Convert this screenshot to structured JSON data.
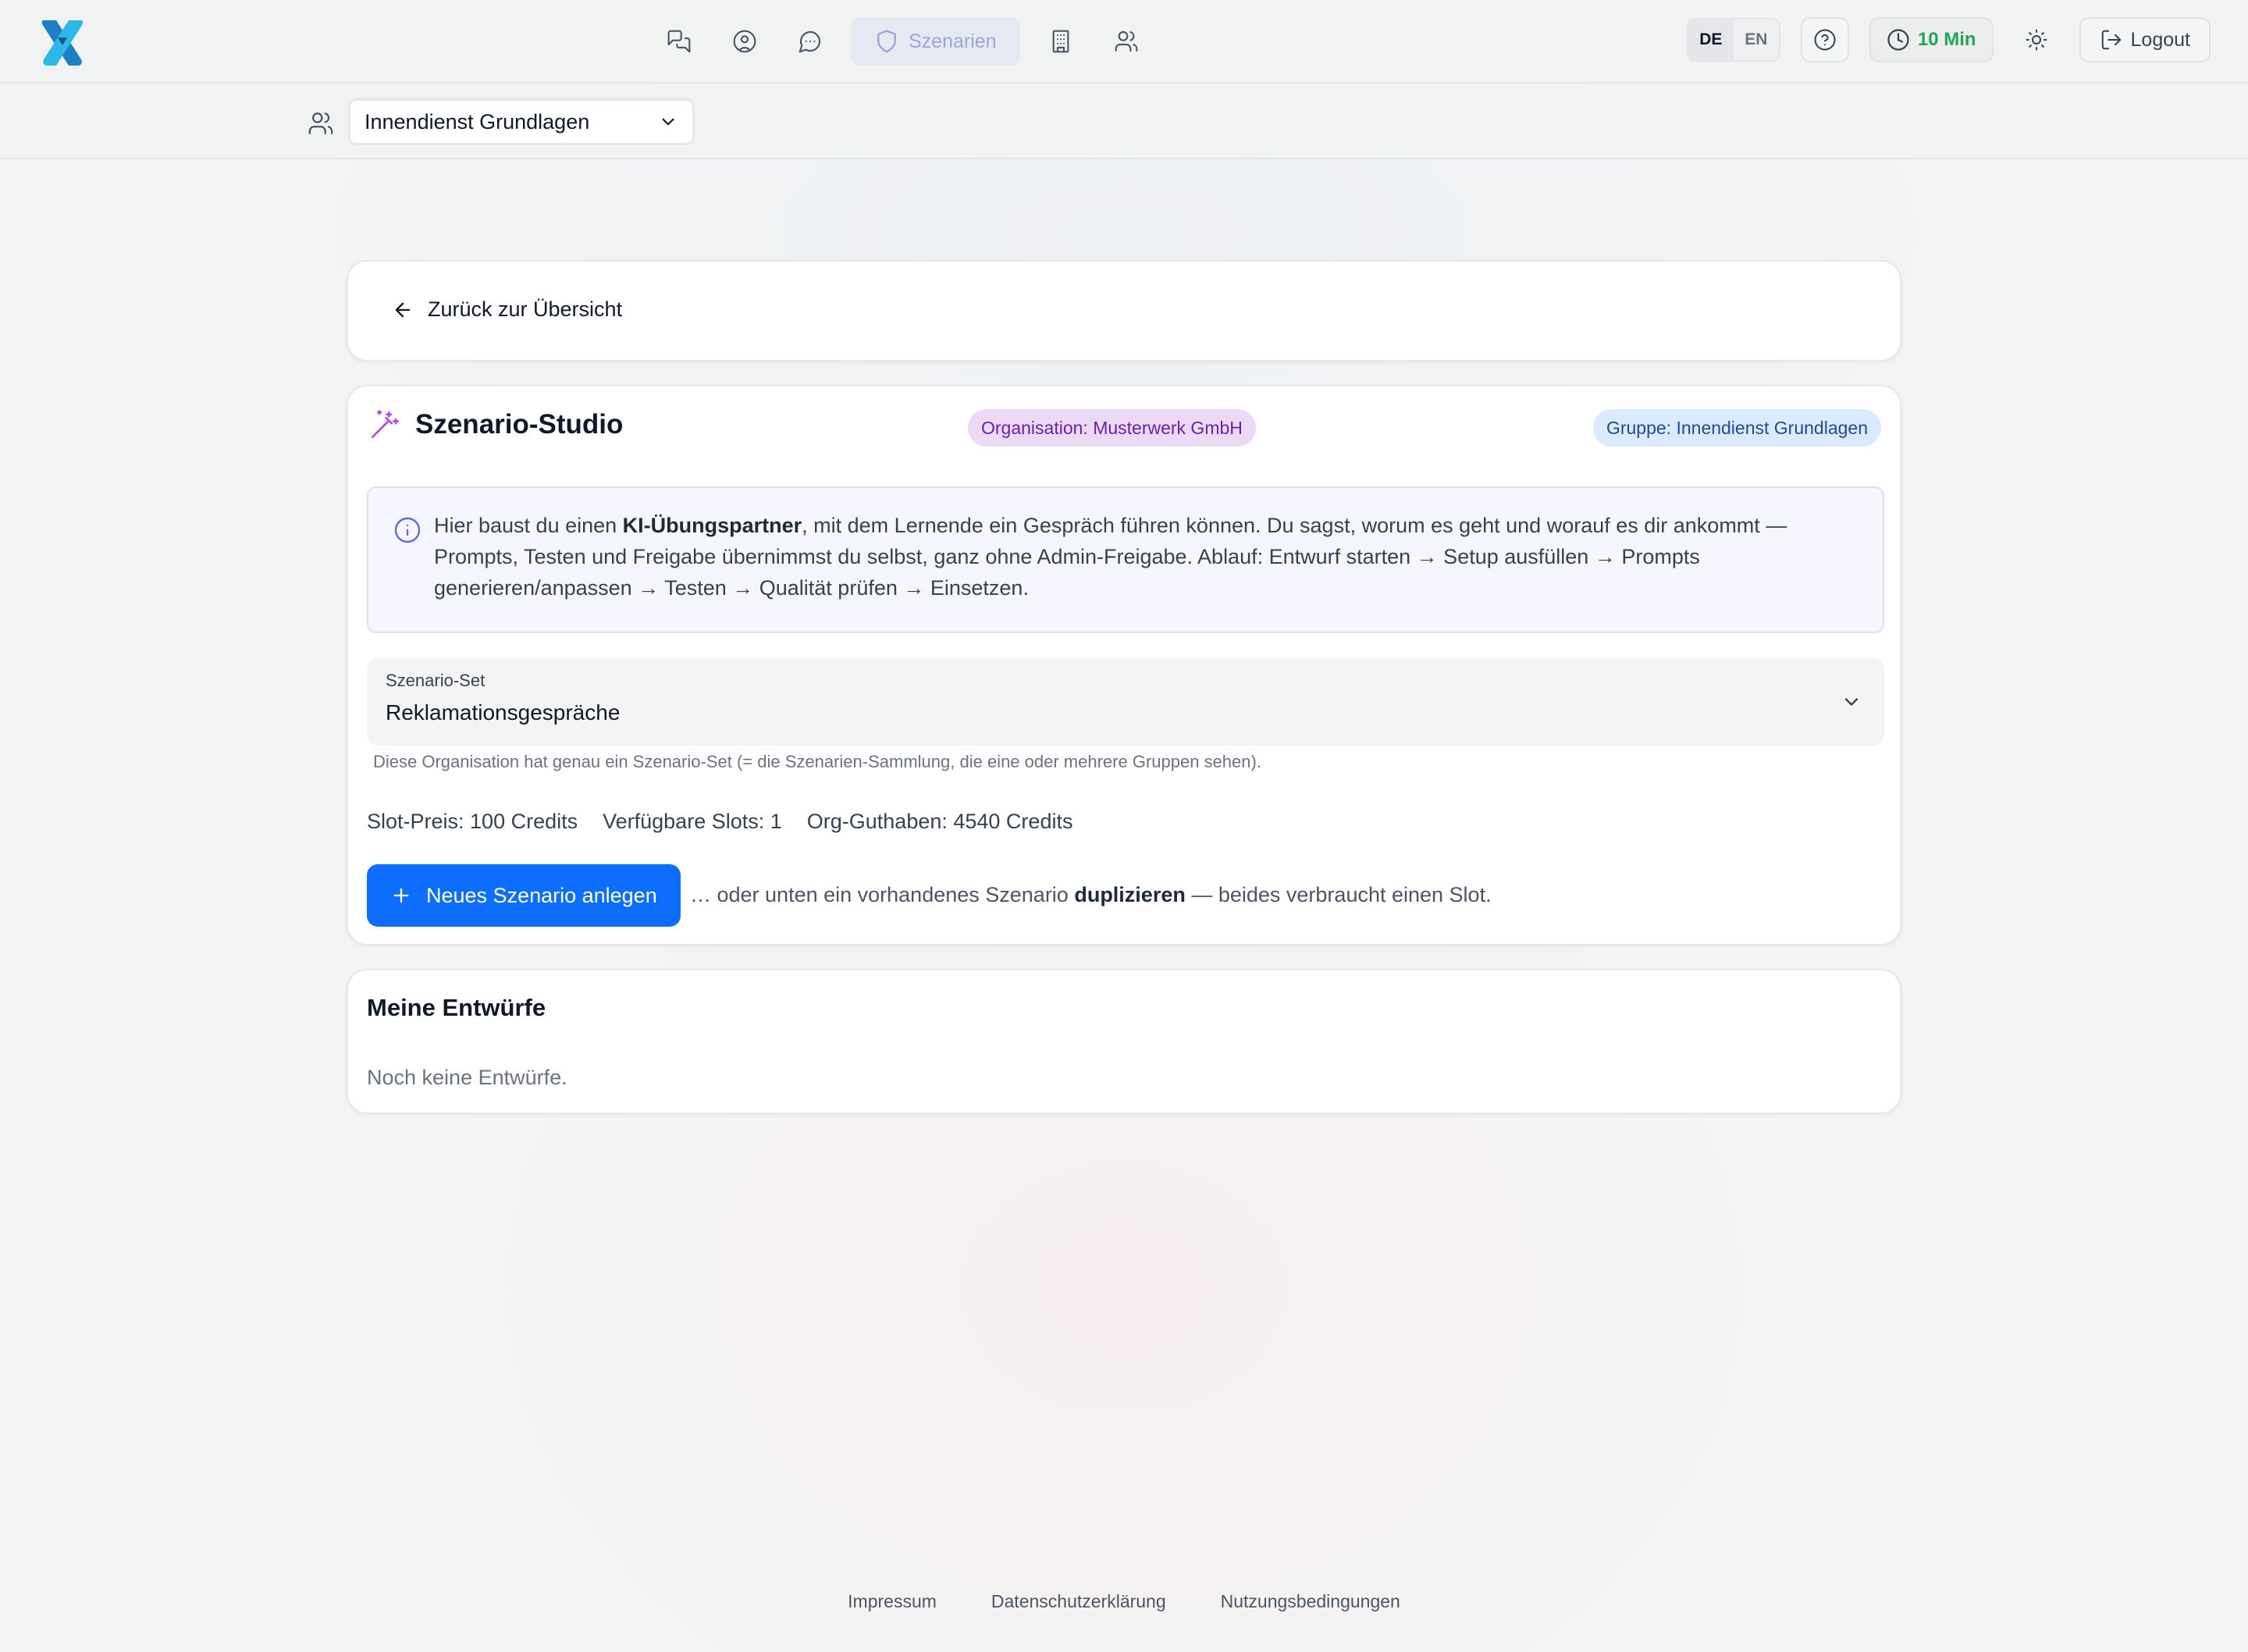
{
  "header": {
    "nav": [
      {
        "icon": "chat-bubbles-icon"
      },
      {
        "icon": "user-circle-icon"
      },
      {
        "icon": "message-circle-icon"
      },
      {
        "icon": "shield-icon",
        "label": "Szenarien"
      },
      {
        "icon": "building-icon"
      },
      {
        "icon": "users-icon"
      }
    ],
    "lang": {
      "de": "DE",
      "en": "EN"
    },
    "timer": "10 Min",
    "logout": "Logout"
  },
  "subbar": {
    "group_selected": "Innendienst Grundlagen"
  },
  "back": {
    "label": "Zurück zur Übersicht"
  },
  "studio": {
    "title": "Szenario-Studio",
    "badge_org": "Organisation: Musterwerk GmbH",
    "badge_group": "Gruppe: Innendienst Grundlagen",
    "info": {
      "pre": "Hier baust du einen ",
      "bold": "KI-Übungspartner",
      "post": ", mit dem Lernende ein Gespräch führen können. Du sagst, worum es geht und worauf es dir ankommt — Prompts, Testen und Freigabe übernimmst du selbst, ganz ohne Admin-Freigabe. Ablauf: Entwurf starten → Setup ausfüllen → Prompts generieren/anpassen → Testen → Qualität prüfen → Einsetzen."
    },
    "set_label": "Szenario-Set",
    "set_value": "Reklamationsgespräche",
    "set_hint": "Diese Organisation hat genau ein Szenario-Set (= die Szenarien-Sammlung, die eine oder mehrere Gruppen sehen).",
    "stats": {
      "slot_price": "Slot-Preis: 100 Credits",
      "slots": "Verfügbare Slots: 1",
      "balance": "Org-Guthaben: 4540 Credits"
    },
    "new_button": "Neues Szenario anlegen",
    "dup_note": {
      "pre": "… oder unten ein vorhandenes Szenario ",
      "bold": "duplizieren",
      "post": " — beides verbraucht einen Slot."
    }
  },
  "drafts": {
    "title": "Meine Entwürfe",
    "empty": "Noch keine Entwürfe."
  },
  "footer": {
    "links": [
      "Impressum",
      "Datenschutzerklärung",
      "Nutzungsbedingungen"
    ]
  }
}
